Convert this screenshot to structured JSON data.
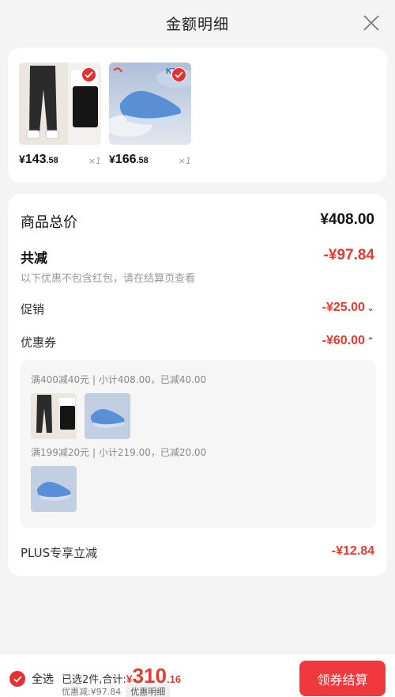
{
  "header": {
    "title": "金额明细"
  },
  "products": [
    {
      "price_currency": "¥",
      "price_int": "143",
      "price_dec": ".58",
      "qty": "×1",
      "type": "pants"
    },
    {
      "price_currency": "¥",
      "price_int": "166",
      "price_dec": ".58",
      "qty": "×1",
      "type": "shoe"
    }
  ],
  "summary": {
    "total_label": "商品总价",
    "total_value": "¥408.00",
    "discount_label": "共减",
    "discount_value": "-¥97.84",
    "discount_note": "以下优惠不包含红包，请在结算页查看",
    "promo_label": "促销",
    "promo_value": "-¥25.00",
    "coupon_label": "优惠券",
    "coupon_value": "-¥60.00",
    "plus_label": "PLUS专享立减",
    "plus_value": "-¥12.84"
  },
  "coupons": [
    {
      "text": "满400减40元 | 小计408.00，已减40.00"
    },
    {
      "text": "满199减20元 | 小计219.00，已减20.00"
    }
  ],
  "bottom": {
    "select_all": "全选",
    "selected_prefix": "已选2件,合计:",
    "total_currency": "¥",
    "total_int": "310",
    "total_dec": ".16",
    "discount_text": "优惠减:¥97.84",
    "detail_tag": "优惠明细",
    "checkout": "领券结算"
  },
  "colors": {
    "accent": "#e53a2f",
    "button": "#f0393f",
    "check": "#e63030"
  }
}
